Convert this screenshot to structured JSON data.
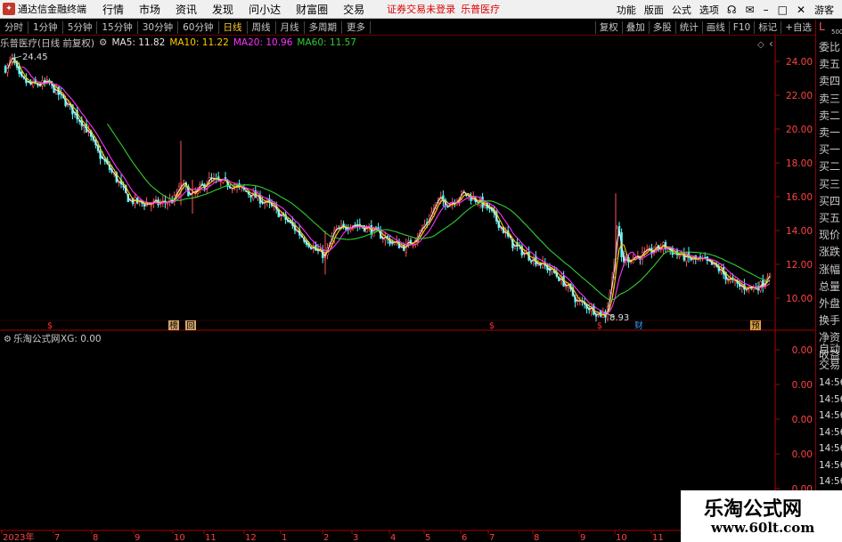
{
  "titlebar": {
    "app_name": "通达信金融终端",
    "menus": [
      "行情",
      "市场",
      "资讯",
      "发现",
      "问小达",
      "财富圈",
      "交易"
    ],
    "status": "证券交易未登录",
    "stock_name": "乐普医疗",
    "right_items": [
      "功能",
      "版面",
      "公式",
      "选项"
    ],
    "user": "游客"
  },
  "periods": [
    "分时",
    "1分钟",
    "5分钟",
    "15分钟",
    "30分钟",
    "60分钟",
    "日线",
    "周线",
    "月线",
    "多周期",
    "更多"
  ],
  "active_period": "日线",
  "right_tools": [
    "复权",
    "叠加",
    "多股",
    "统计",
    "画线",
    "F10",
    "标记",
    "+自选"
  ],
  "indicator": {
    "stock_label": "乐普医疗(日线 前复权)",
    "ma5": "MA5: 11.82",
    "ma10": "MA10: 11.22",
    "ma20": "MA20: 10.96",
    "ma60": "MA60: 11.57"
  },
  "sub_indicator": {
    "label": "乐淘公式网",
    "xg": "XG: 0.00"
  },
  "colors": {
    "ma5": "#e6e6e6",
    "ma10": "#ffcc00",
    "ma20": "#ff33ff",
    "ma60": "#33cc33",
    "up": "#ff5555",
    "down": "#54ffff",
    "axis": "#aa0000"
  },
  "price_axis": [
    "24.00",
    "22.00",
    "20.00",
    "18.00",
    "16.00",
    "14.00",
    "12.00",
    "10.00"
  ],
  "sub_axis": [
    "0.00",
    "0.00",
    "0.00",
    "0.00",
    "0.00",
    "0.00"
  ],
  "annotations": {
    "high": "24.45",
    "low": "8.93"
  },
  "event_marks": [
    "$",
    "榜",
    "回",
    "$",
    "$",
    "财",
    "预"
  ],
  "x_axis_labels": [
    "2023年",
    "7",
    "8",
    "9",
    "10",
    "11",
    "12",
    "1",
    "2",
    "3",
    "4",
    "5",
    "6",
    "7",
    "8",
    "9",
    "10",
    "11"
  ],
  "side_labels": [
    "委比",
    "卖五",
    "卖四",
    "卖三",
    "卖二",
    "卖一",
    "买一",
    "买二",
    "买三",
    "买四",
    "买五",
    "现价",
    "涨跌",
    "涨幅",
    "总量",
    "外盘",
    "换手",
    "净资",
    "收益"
  ],
  "side_bottom": [
    "自动",
    "交易"
  ],
  "side_times": [
    "14:56",
    "14:56",
    "14:56",
    "14:56",
    "14:56",
    "14:56",
    "14:56",
    "14:56"
  ],
  "side_top": "L",
  "side_top_sub": "500",
  "watermark": {
    "line1": "乐淘公式网",
    "line2": "www.60lt.com"
  }
}
